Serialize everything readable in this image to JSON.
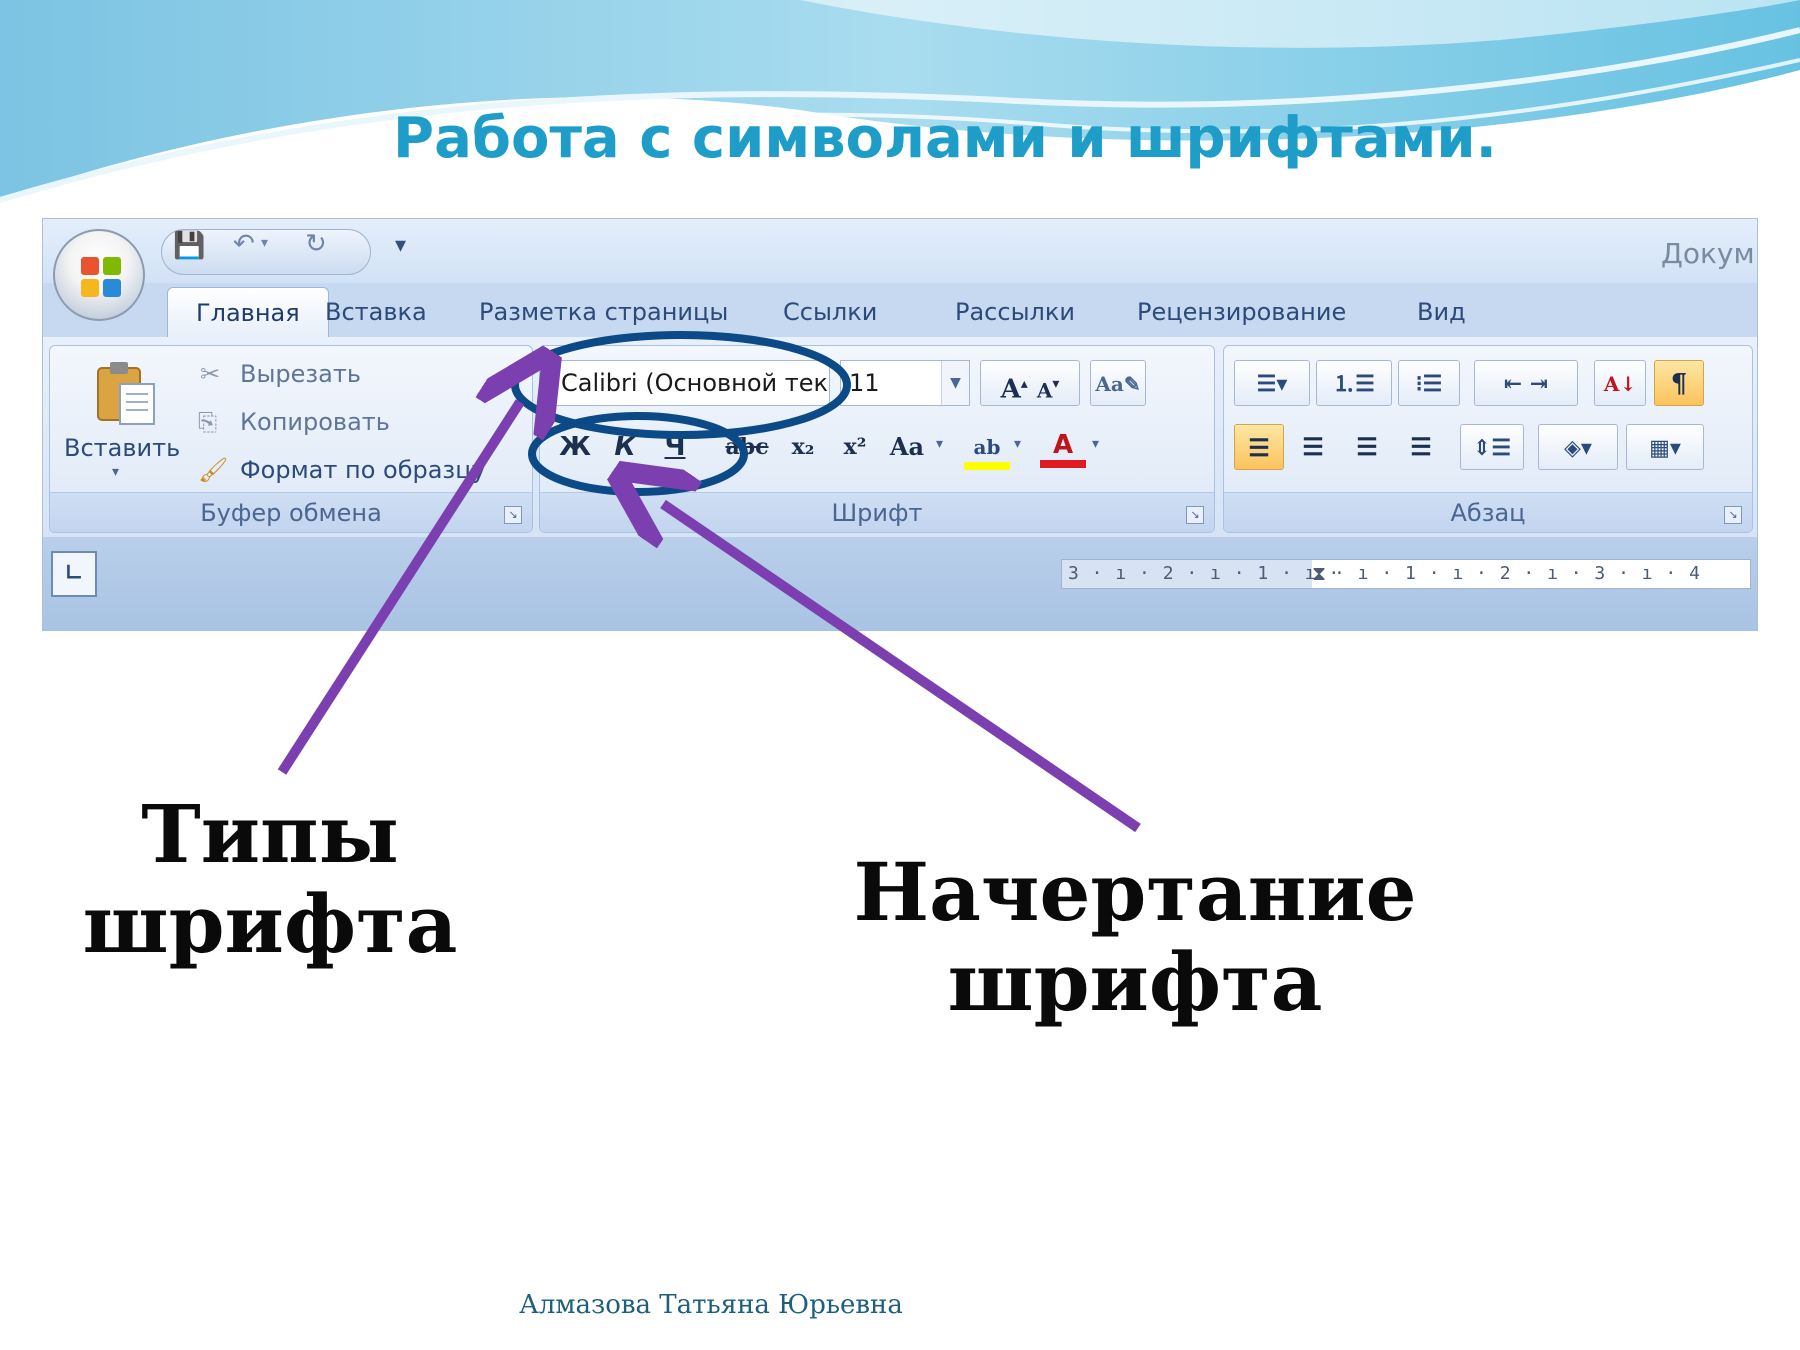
{
  "slide": {
    "title": "Работа с символами и шрифтами.",
    "author": "Алмазова Татьяна Юрьевна"
  },
  "word_window": {
    "doc_title": "Докум",
    "tabs": [
      {
        "label": "Главная",
        "active": true
      },
      {
        "label": "Вставка"
      },
      {
        "label": "Разметка страницы"
      },
      {
        "label": "Ссылки"
      },
      {
        "label": "Рассылки"
      },
      {
        "label": "Рецензирование"
      },
      {
        "label": "Вид"
      }
    ],
    "clipboard": {
      "paste": "Вставить",
      "cut": "Вырезать",
      "copy": "Копировать",
      "format_painter": "Формат по образцу",
      "group_label": "Буфер обмена"
    },
    "font": {
      "font_name": "Calibri (Основной текст)",
      "font_size": "11",
      "bold": "Ж",
      "italic": "К",
      "underline": "Ч",
      "strike": "abc",
      "subscript": "x₂",
      "superscript": "x²",
      "change_case": "Aa",
      "grow": "A",
      "shrink": "A",
      "highlight": "ab",
      "font_color": "A",
      "group_label": "Шрифт"
    },
    "paragraph": {
      "group_label": "Абзац",
      "show_marks": "¶"
    },
    "ruler": {
      "left": "3 · ı · 2 · ı · 1 · ı ·",
      "right": "· ı · 1 · ı · 2 · ı · 3 · ı · 4"
    },
    "colors": {
      "accent_circle": "#0b4a86",
      "arrow": "#7b3fb0",
      "title": "#1f9dc9"
    }
  },
  "annotations": {
    "font_types": "Типы шрифта",
    "font_style": "Начертание шрифта"
  }
}
